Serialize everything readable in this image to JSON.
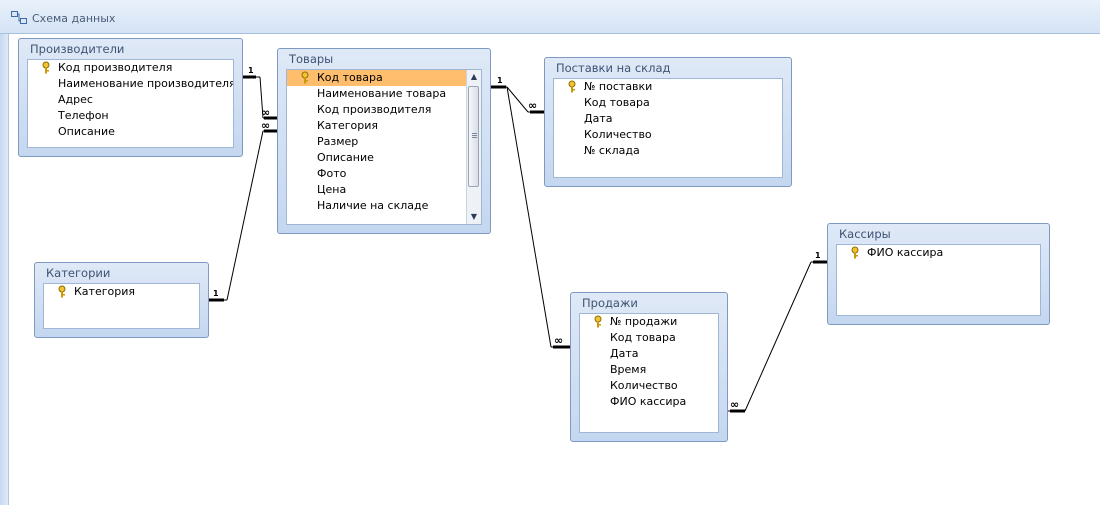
{
  "window": {
    "title": "Схема данных"
  },
  "tables": {
    "manufacturers": {
      "title": "Производители",
      "fields": [
        {
          "name": "Код производителя",
          "key": true
        },
        {
          "name": "Наименование производителя",
          "key": false
        },
        {
          "name": "Адрес",
          "key": false
        },
        {
          "name": "Телефон",
          "key": false
        },
        {
          "name": "Описание",
          "key": false
        }
      ]
    },
    "categories": {
      "title": "Категории",
      "fields": [
        {
          "name": "Категория",
          "key": true
        }
      ]
    },
    "goods": {
      "title": "Товары",
      "fields": [
        {
          "name": "Код товара",
          "key": true,
          "selected": true
        },
        {
          "name": "Наименование товара",
          "key": false
        },
        {
          "name": "Код производителя",
          "key": false
        },
        {
          "name": "Категория",
          "key": false
        },
        {
          "name": "Размер",
          "key": false
        },
        {
          "name": "Описание",
          "key": false
        },
        {
          "name": "Фото",
          "key": false
        },
        {
          "name": "Цена",
          "key": false
        },
        {
          "name": "Наличие на складе",
          "key": false
        }
      ]
    },
    "deliveries": {
      "title": "Поставки на склад",
      "fields": [
        {
          "name": "№ поставки",
          "key": true
        },
        {
          "name": "Код товара",
          "key": false
        },
        {
          "name": "Дата",
          "key": false
        },
        {
          "name": "Количество",
          "key": false
        },
        {
          "name": "№ склада",
          "key": false
        }
      ]
    },
    "sales": {
      "title": "Продажи",
      "fields": [
        {
          "name": "№ продажи",
          "key": true
        },
        {
          "name": "Код товара",
          "key": false
        },
        {
          "name": "Дата",
          "key": false
        },
        {
          "name": "Время",
          "key": false
        },
        {
          "name": "Количество",
          "key": false
        },
        {
          "name": "ФИО кассира",
          "key": false
        }
      ]
    },
    "cashiers": {
      "title": "Кассиры",
      "fields": [
        {
          "name": "ФИО кассира",
          "key": true
        }
      ]
    }
  },
  "relationships": [
    {
      "from": "manufacturers",
      "to": "goods",
      "one": "1",
      "many": "∞"
    },
    {
      "from": "categories",
      "to": "goods",
      "one": "1",
      "many": "∞"
    },
    {
      "from": "goods",
      "to": "deliveries",
      "one": "1",
      "many": "∞"
    },
    {
      "from": "goods",
      "to": "sales",
      "one": "1",
      "many": "∞"
    },
    {
      "from": "cashiers",
      "to": "sales",
      "one": "1",
      "many": "∞"
    }
  ]
}
